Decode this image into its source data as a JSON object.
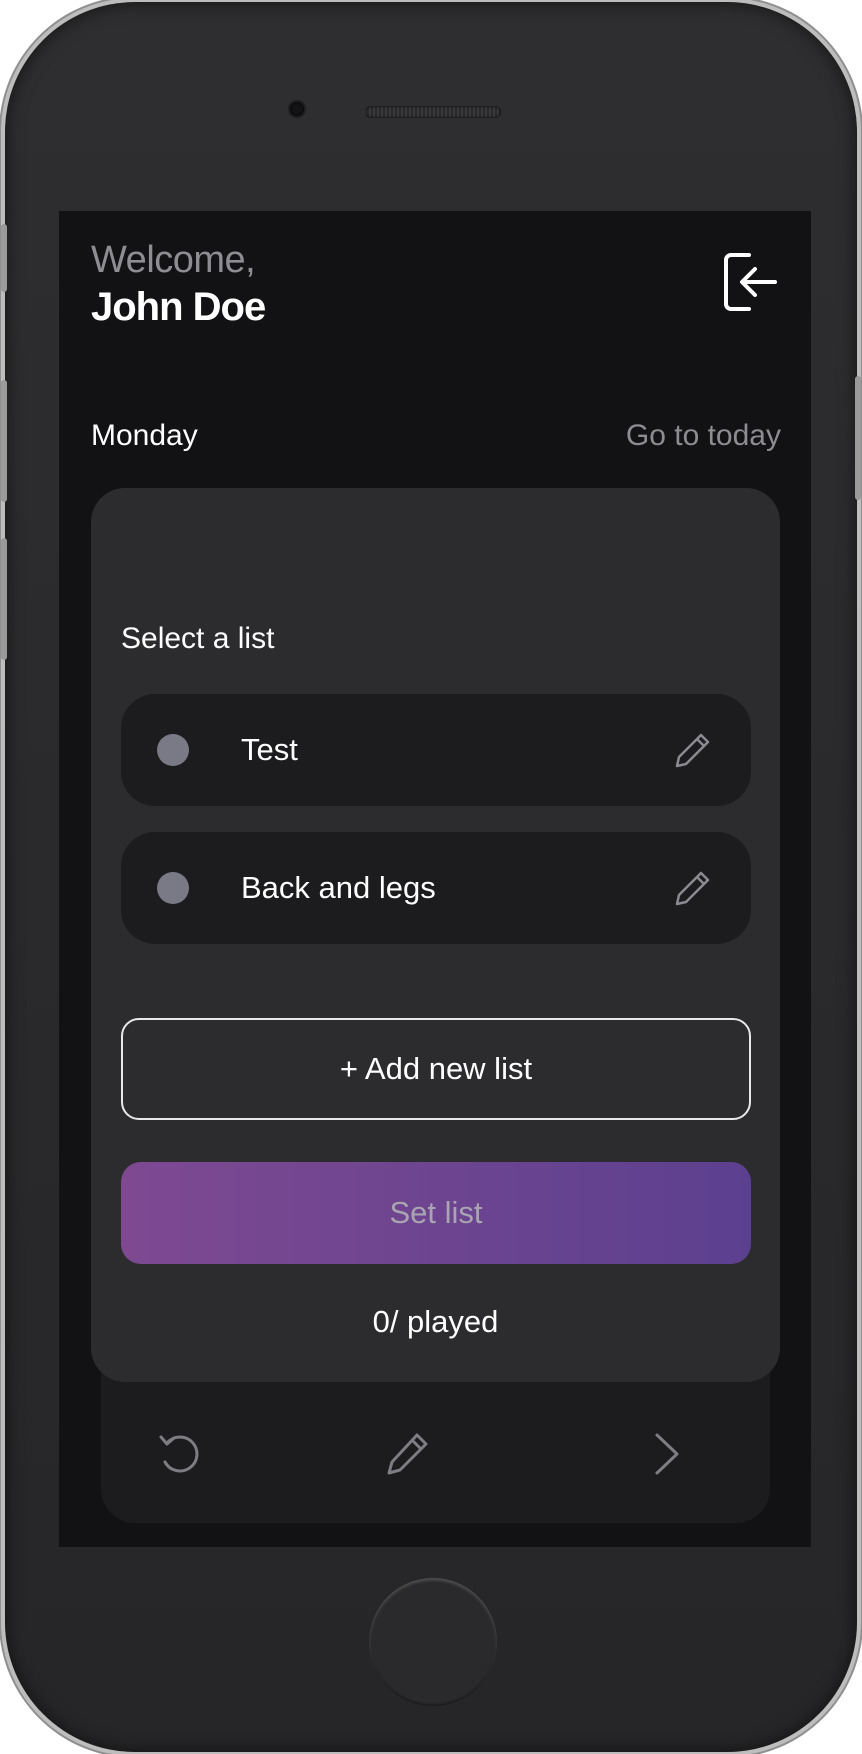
{
  "header": {
    "welcome": "Welcome,",
    "user_name": "John Doe",
    "logout_icon": "logout-arrow-icon"
  },
  "day_bar": {
    "day": "Monday",
    "go_today": "Go to today"
  },
  "card": {
    "title": "Select a list",
    "lists": [
      {
        "label": "Test",
        "dot_color": "#7a7a86",
        "edit_icon": "pencil-icon"
      },
      {
        "label": "Back and legs",
        "dot_color": "#7a7a86",
        "edit_icon": "pencil-icon"
      }
    ],
    "add_label": "+ Add new list",
    "set_label": "Set list",
    "played": "0/ played"
  },
  "toolbar": {
    "icons": [
      "undo-icon",
      "pencil-icon",
      "chevron-right-icon"
    ]
  },
  "colors": {
    "background": "#121215",
    "card": "#2c2c2f",
    "item": "#1c1c1e",
    "accent_start": "#7e4991",
    "accent_end": "#5c4090",
    "muted_text": "#8c8c91"
  }
}
